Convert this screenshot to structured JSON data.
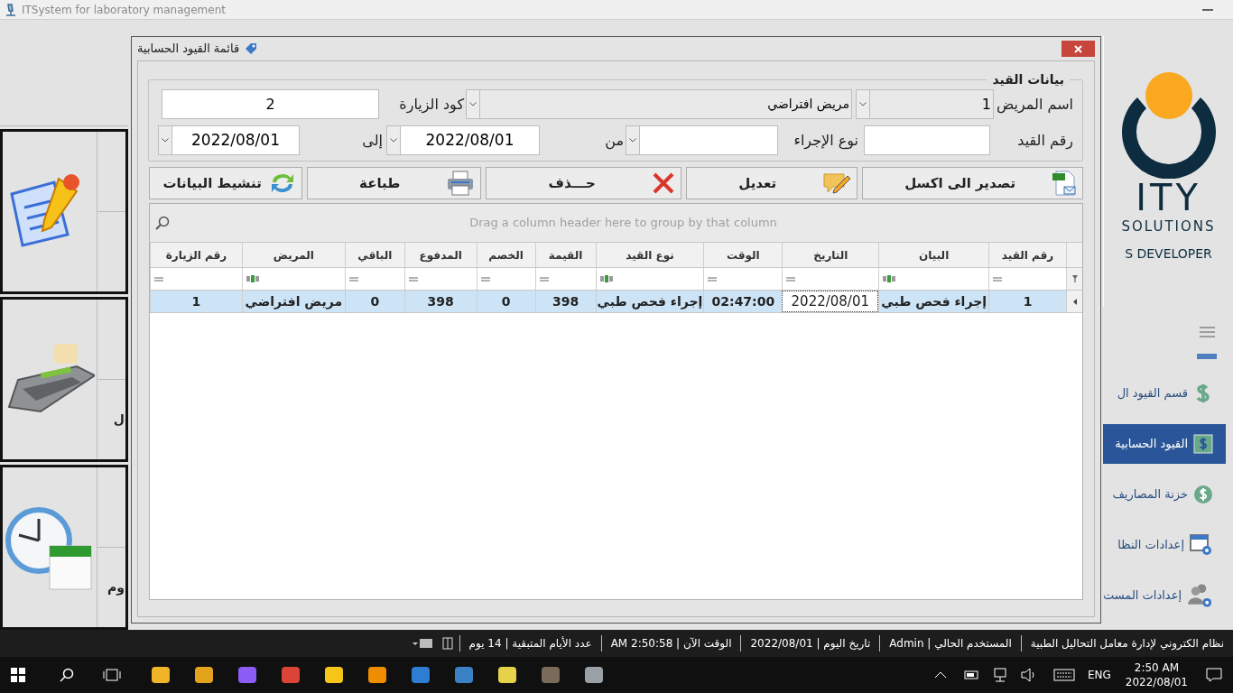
{
  "app": {
    "title": "ITSystem for laboratory management"
  },
  "left_tiles": [
    {
      "kind": "document"
    },
    {
      "kind": "register",
      "label": "ل"
    },
    {
      "kind": "clock",
      "label": "وم"
    }
  ],
  "logo": {
    "lines": [
      "ITY",
      "SOLUTIONS",
      "S DEVELOPER"
    ]
  },
  "side_menu": {
    "items": [
      {
        "label": "قسم القيود ال",
        "kind": "dollar",
        "selected": false
      },
      {
        "label": "القيود الحسابية",
        "kind": "dollarbox",
        "selected": true
      },
      {
        "label": "خزنة المصاريف",
        "kind": "coin",
        "selected": false
      },
      {
        "label": "إعدادات النظا",
        "kind": "system",
        "selected": false
      },
      {
        "label": "إعدادات المست",
        "kind": "users",
        "selected": false
      }
    ]
  },
  "dialog": {
    "title": "قائمة القيود الحسابية",
    "group_title": "بيانات القيد",
    "patient": {
      "label": "اسم المريض",
      "code": "1",
      "name": "مريض افتراضي"
    },
    "visit_code": {
      "label": "كود الزيارة",
      "value": "2"
    },
    "entry_number": {
      "label": "رقم القيد"
    },
    "procedure_type": {
      "label": "نوع الإجراء"
    },
    "date_from": {
      "label": "من",
      "value": "2022/08/01"
    },
    "date_to": {
      "label": "إلى",
      "value": "2022/08/01"
    },
    "buttons": [
      {
        "label": "تصدير الى اكسل",
        "kind": "export"
      },
      {
        "label": "تعديل",
        "kind": "edit"
      },
      {
        "label": "حـــذف",
        "kind": "delete"
      },
      {
        "label": "طباعة",
        "kind": "print"
      },
      {
        "label": "تنشيط البيانات",
        "kind": "refresh"
      }
    ],
    "grid": {
      "group_hint": "Drag a column header here to group by that column",
      "columns": [
        {
          "label": "رقم القيد",
          "kind": "number"
        },
        {
          "label": "البيان",
          "kind": "text"
        },
        {
          "label": "التاريخ",
          "kind": "number"
        },
        {
          "label": "الوقت",
          "kind": "number"
        },
        {
          "label": "نوع القيد",
          "kind": "text"
        },
        {
          "label": "القيمة",
          "kind": "number"
        },
        {
          "label": "الخصم",
          "kind": "number"
        },
        {
          "label": "المدفوع",
          "kind": "number"
        },
        {
          "label": "الباقي",
          "kind": "number"
        },
        {
          "label": "المريض",
          "kind": "text"
        },
        {
          "label": "رقم الزيارة",
          "kind": "number"
        }
      ],
      "rows": [
        {
          "selected": true,
          "cells": [
            {
              "text": "1",
              "focused": false
            },
            {
              "text": "إجراء فحص طبي",
              "focused": false
            },
            {
              "text": "2022/08/01",
              "focused": true
            },
            {
              "text": "02:47:00",
              "focused": false
            },
            {
              "text": "إجراء فحص طبي",
              "focused": false
            },
            {
              "text": "398",
              "focused": false
            },
            {
              "text": "0",
              "focused": false
            },
            {
              "text": "398",
              "focused": false
            },
            {
              "text": "0",
              "focused": false
            },
            {
              "text": "مريض افتراضي",
              "focused": false
            },
            {
              "text": "1",
              "focused": false
            }
          ]
        }
      ]
    }
  },
  "status_bar": {
    "items": [
      "نظام الكتروني لإدارة معامل التحاليل الطبية",
      "المستخدم الحالي | Admin",
      "تاريخ اليوم | 2022/08/01",
      "الوقت الآن | 2:50:58 AM",
      "عدد الأيام المتبقية | 14  يوم"
    ]
  },
  "taskbar": {
    "language": "ENG",
    "time": "2:50 AM",
    "date": "2022/08/01"
  }
}
